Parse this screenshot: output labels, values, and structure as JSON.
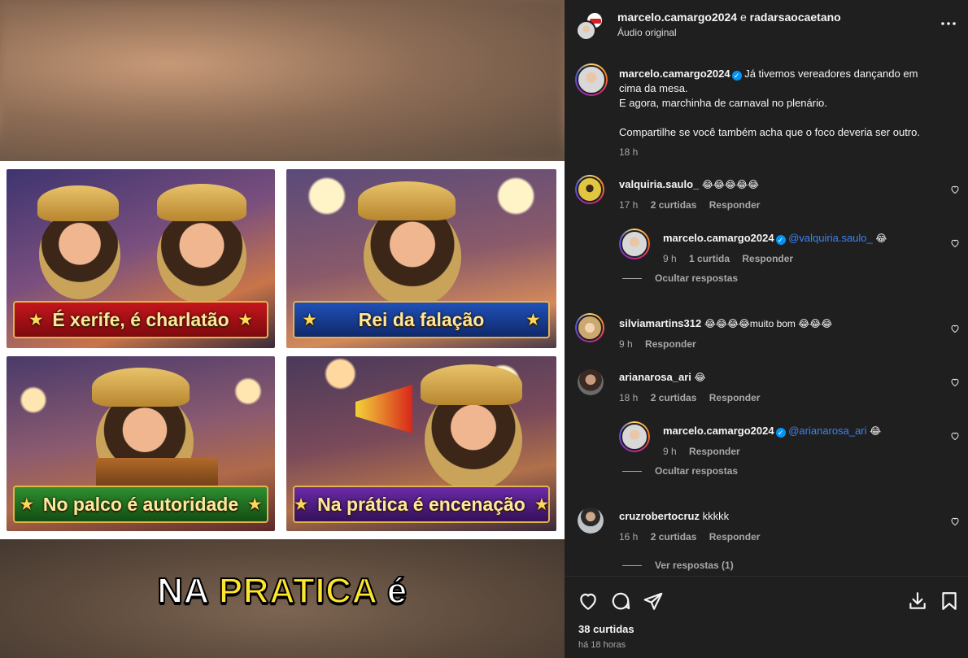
{
  "post": {
    "header_user": "marcelo.camargo2024",
    "header_and": "e",
    "header_collab": "radarsaocaetano",
    "audio_label": "Áudio original",
    "more_icon": "more-horizontal-icon"
  },
  "media": {
    "panels": [
      {
        "banner": "É xerife, é charlatão",
        "color": "#b3141a"
      },
      {
        "banner": "Rei da falação",
        "color": "#1d4aa8"
      },
      {
        "banner": "No palco é autoridade",
        "color": "#2a8a2a"
      },
      {
        "banner": "Na prática é encenação",
        "color": "#5e2596"
      }
    ],
    "caption_word1": "NA",
    "caption_word2": "PRATICA",
    "caption_word3": "é"
  },
  "caption_comment": {
    "user": "marcelo.camargo2024",
    "text_line1": "Já tivemos vereadores dançando em",
    "text_line2": "cima da mesa.",
    "text_line3": "E agora, marchinha de carnaval no plenário.",
    "text_line4": "Compartilhe se você também acha que o foco deveria ser outro.",
    "time": "18 h"
  },
  "comments": [
    {
      "user": "valquiria.saulo_",
      "text": "😂😂😂😂😂",
      "time": "17 h",
      "likes": "2 curtidas",
      "reply": "Responder"
    },
    {
      "user": "marcelo.camargo2024",
      "mention": "@valquiria.saulo_",
      "text": "😂",
      "time": "9 h",
      "likes": "1 curtida",
      "reply": "Responder",
      "toggle": "Ocultar respostas"
    },
    {
      "user": "silviamartins312",
      "text": "😂😂😂😂muito bom 😂😂😂",
      "time": "9 h",
      "reply": "Responder"
    },
    {
      "user": "arianarosa_ari",
      "text": "😂",
      "time": "18 h",
      "likes": "2 curtidas",
      "reply": "Responder"
    },
    {
      "user": "marcelo.camargo2024",
      "mention": "@arianarosa_ari",
      "text": "😂",
      "time": "9 h",
      "reply": "Responder",
      "toggle": "Ocultar respostas"
    },
    {
      "user": "cruzrobertocruz",
      "text": "kkkkk",
      "time": "16 h",
      "likes": "2 curtidas",
      "reply": "Responder",
      "toggle": "Ver respostas (1)"
    }
  ],
  "footer": {
    "likes": "38 curtidas",
    "when": "há 18 horas"
  },
  "colors": {
    "sidebar_bg": "#1f1f1f",
    "text": "#f5f5f5",
    "muted": "#a8a8a8",
    "link": "#3b82f6",
    "verified": "#0095f6"
  }
}
